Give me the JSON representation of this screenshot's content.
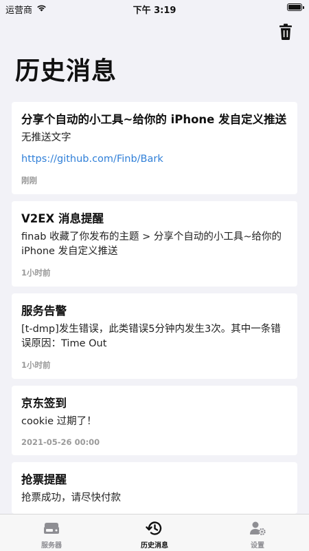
{
  "status_bar": {
    "carrier": "运营商",
    "time": "下午 3:19"
  },
  "header": {
    "title": "历史消息",
    "trash_icon": "trash-icon"
  },
  "messages": [
    {
      "title": "分享个自动的小工具~给你的 iPhone 发自定义推送",
      "body": "无推送文字",
      "link": "https://github.com/Finb/Bark",
      "time": "刚刚"
    },
    {
      "title": "V2EX 消息提醒",
      "body": "finab 收藏了你发布的主题 > 分享个自动的小工具~给你的 iPhone 发自定义推送",
      "time": "1小时前"
    },
    {
      "title": "服务告警",
      "body": "[t-dmp]发生错误，此类错误5分钟内发生3次。其中一条错误原因：Time Out",
      "time": "1小时前"
    },
    {
      "title": "京东签到",
      "body": "cookie 过期了！",
      "time": "2021-05-26 00:00"
    },
    {
      "title": "抢票提醒",
      "body": "抢票成功，请尽快付款"
    }
  ],
  "tabbar": {
    "tabs": [
      {
        "label": "服务器",
        "icon": "server-icon",
        "active": false
      },
      {
        "label": "历史消息",
        "icon": "history-icon",
        "active": true
      },
      {
        "label": "设置",
        "icon": "settings-user-icon",
        "active": false
      }
    ]
  },
  "colors": {
    "background": "#f2f2f7",
    "link": "#2f7fd8",
    "inactive_tab": "#8e8e93"
  }
}
